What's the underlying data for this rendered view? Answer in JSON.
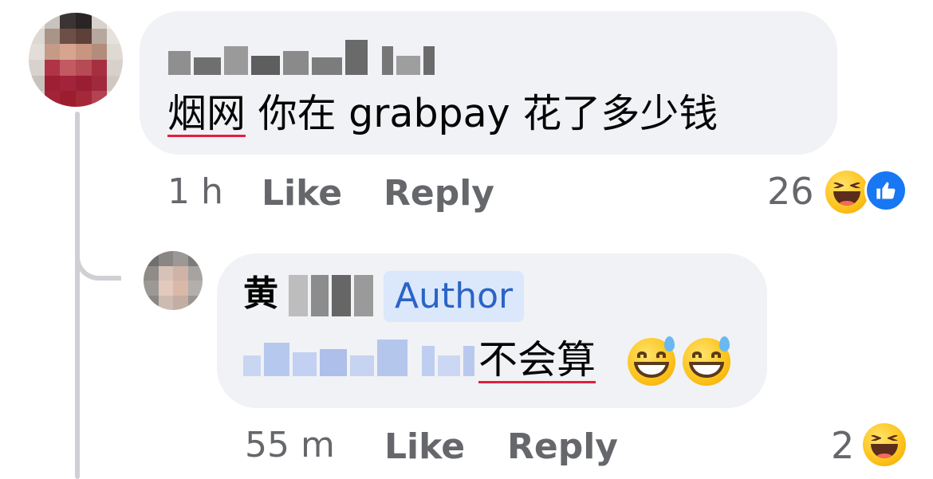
{
  "comment": {
    "body_underlined": "烟网",
    "body_rest": " 你在 grabpay 花了多少钱",
    "time": "1 h",
    "like_label": "Like",
    "reply_label": "Reply",
    "reaction_count": "26",
    "reactions": [
      "haha-icon",
      "like-icon"
    ]
  },
  "reply": {
    "author_first_char": "黄",
    "author_badge": "Author",
    "body_underlined": "不会算",
    "emojis": [
      "grinning-sweat-icon",
      "grinning-sweat-icon"
    ],
    "time": "55 m",
    "like_label": "Like",
    "reply_label": "Reply",
    "reaction_count": "2",
    "reactions": [
      "haha-icon"
    ]
  },
  "colors": {
    "bubble": "#f0f2f5",
    "meta_text": "#65676b",
    "author_badge_bg": "#dbe7fb",
    "author_badge_text": "#2a64c6",
    "spellcheck_underline": "#e41e3f",
    "like_blue": "#1877f2"
  }
}
